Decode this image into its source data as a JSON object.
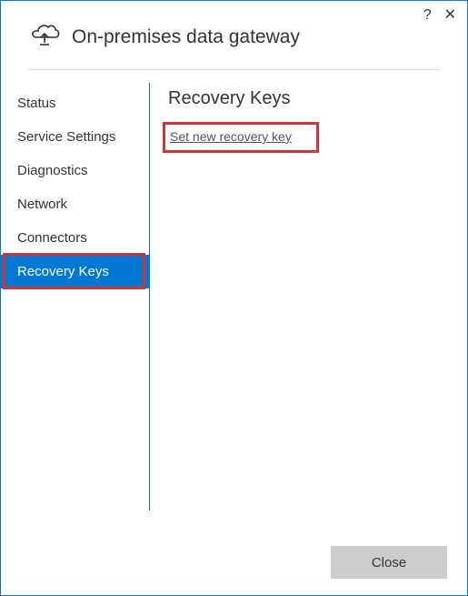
{
  "header": {
    "title": "On-premises data gateway"
  },
  "sidebar": {
    "items": [
      {
        "label": "Status"
      },
      {
        "label": "Service Settings"
      },
      {
        "label": "Diagnostics"
      },
      {
        "label": "Network"
      },
      {
        "label": "Connectors"
      },
      {
        "label": "Recovery Keys"
      }
    ]
  },
  "main": {
    "title": "Recovery Keys",
    "set_link": "Set new recovery key"
  },
  "footer": {
    "close_label": "Close"
  },
  "titlebar": {
    "help": "?",
    "close": "✕"
  }
}
